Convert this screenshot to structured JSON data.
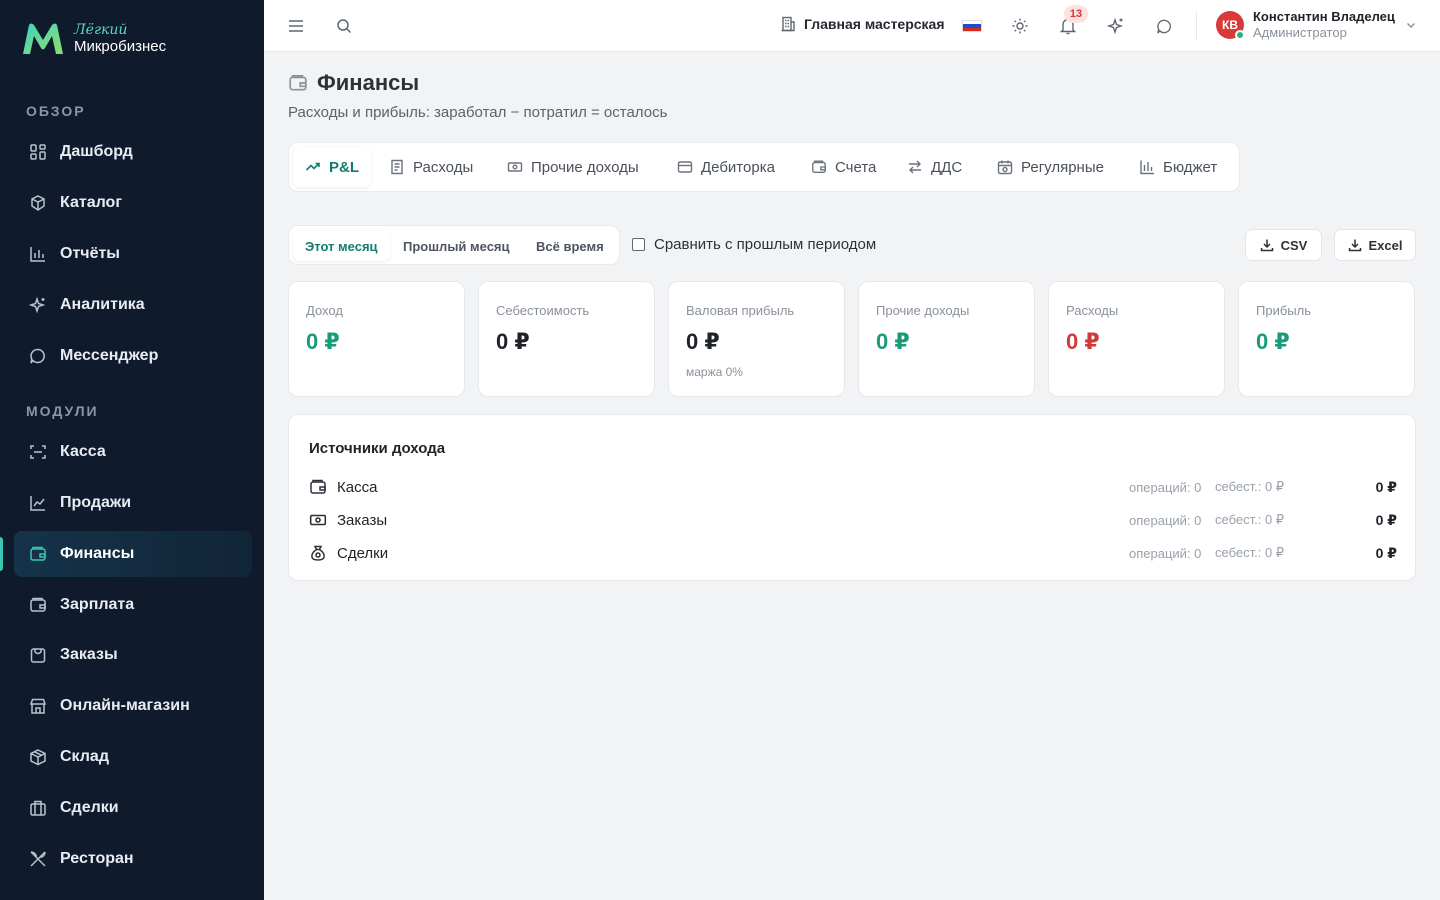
{
  "app": {
    "logo_top": "Лёгкий",
    "logo_bottom": "Микробизнес",
    "brand_colors": {
      "accent": "#127d6e",
      "sidebar_bg": "#0f1b2d",
      "positive": "#1a9b78",
      "negative": "#d23a3a"
    }
  },
  "sidebar": {
    "section_overview": "ОБЗОР",
    "section_modules": "МОДУЛИ",
    "overview_items": [
      {
        "label": "Дашборд",
        "icon": "dashboard-icon"
      },
      {
        "label": "Каталог",
        "icon": "catalog-icon"
      },
      {
        "label": "Отчёты",
        "icon": "reports-icon"
      },
      {
        "label": "Аналитика",
        "icon": "analytics-icon"
      },
      {
        "label": "Мессенджер",
        "icon": "messenger-icon"
      }
    ],
    "module_items": [
      {
        "label": "Касса",
        "icon": "cash-register-icon"
      },
      {
        "label": "Продажи",
        "icon": "sales-icon"
      },
      {
        "label": "Финансы",
        "icon": "finance-icon",
        "active": true
      },
      {
        "label": "Зарплата",
        "icon": "salary-icon"
      },
      {
        "label": "Заказы",
        "icon": "orders-icon"
      },
      {
        "label": "Онлайн-магазин",
        "icon": "store-icon"
      },
      {
        "label": "Склад",
        "icon": "warehouse-icon"
      },
      {
        "label": "Сделки",
        "icon": "deals-icon"
      },
      {
        "label": "Ресторан",
        "icon": "restaurant-icon"
      }
    ]
  },
  "topbar": {
    "workshop": "Главная мастерская",
    "notifications_count": "13",
    "user_initials": "КВ",
    "user_name": "Константин Владелец",
    "user_role": "Администратор"
  },
  "page": {
    "title": "Финансы",
    "subtitle": "Расходы и прибыль: заработал − потратил = осталось"
  },
  "tabs": [
    {
      "label": "P&L",
      "icon": "trend-up-icon",
      "active": true
    },
    {
      "label": "Расходы",
      "icon": "receipt-icon"
    },
    {
      "label": "Прочие доходы",
      "icon": "banknote-icon"
    },
    {
      "label": "Дебиторка",
      "icon": "card-icon"
    },
    {
      "label": "Счета",
      "icon": "wallet-icon"
    },
    {
      "label": "ДДС",
      "icon": "arrows-exchange-icon"
    },
    {
      "label": "Регулярные",
      "icon": "calendar-repeat-icon"
    },
    {
      "label": "Бюджет",
      "icon": "bar-chart-icon"
    }
  ],
  "period": {
    "options": [
      "Этот месяц",
      "Прошлый месяц",
      "Всё время"
    ],
    "selected": "Этот месяц",
    "compare_label": "Сравнить с прошлым периодом",
    "compare_checked": false
  },
  "export": {
    "csv": "CSV",
    "excel": "Excel"
  },
  "kpis": [
    {
      "label": "Доход",
      "value": "0 ₽",
      "color": "#1a9b78",
      "sub": ""
    },
    {
      "label": "Себестоимость",
      "value": "0 ₽",
      "color": "#1f2329",
      "sub": ""
    },
    {
      "label": "Валовая прибыль",
      "value": "0 ₽",
      "color": "#1f2329",
      "sub": "маржа 0%"
    },
    {
      "label": "Прочие доходы",
      "value": "0 ₽",
      "color": "#1a9b78",
      "sub": ""
    },
    {
      "label": "Расходы",
      "value": "0 ₽",
      "color": "#d23a3a",
      "sub": ""
    },
    {
      "label": "Прибыль",
      "value": "0 ₽",
      "color": "#1a9b78",
      "sub": ""
    }
  ],
  "sources": {
    "title": "Источники дохода",
    "rows": [
      {
        "name": "Касса",
        "icon": "wallet-icon",
        "ops": "операций: 0",
        "cost": "себест.: 0 ₽",
        "amount": "0 ₽"
      },
      {
        "name": "Заказы",
        "icon": "banknote-icon",
        "ops": "операций: 0",
        "cost": "себест.: 0 ₽",
        "amount": "0 ₽"
      },
      {
        "name": "Сделки",
        "icon": "money-bag-icon",
        "ops": "операций: 0",
        "cost": "себест.: 0 ₽",
        "amount": "0 ₽"
      }
    ]
  }
}
